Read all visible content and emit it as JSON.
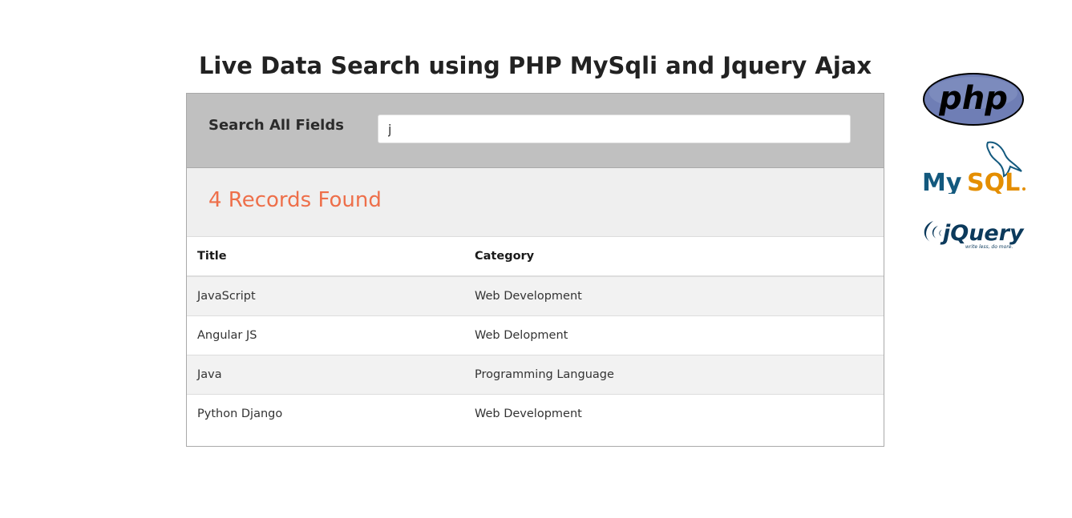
{
  "header": {
    "title": "Live Data Search using PHP MySqli and Jquery Ajax"
  },
  "search": {
    "label": "Search All Fields",
    "value": "j"
  },
  "results": {
    "summary": "4 Records Found",
    "columns": [
      "Title",
      "Category"
    ],
    "rows": [
      [
        "JavaScript",
        "Web Development"
      ],
      [
        "Angular JS",
        "Web Delopment"
      ],
      [
        "Java",
        "Programming Language"
      ],
      [
        "Python Django",
        "Web Development"
      ]
    ]
  },
  "logos": {
    "php_text": "php",
    "mysql_text_my": "My",
    "mysql_text_sql": "SQL",
    "jquery_text": "jQuery",
    "jquery_tagline": "write less, do more."
  },
  "colors": {
    "accent": "#ee6f4a",
    "search_bar_bg": "#c0c0c0",
    "results_header_bg": "#efefef",
    "php_purple": "#6f7eb5",
    "mysql_blue": "#13597e",
    "mysql_orange": "#e48e00",
    "jquery_blue": "#0c3a5c"
  }
}
